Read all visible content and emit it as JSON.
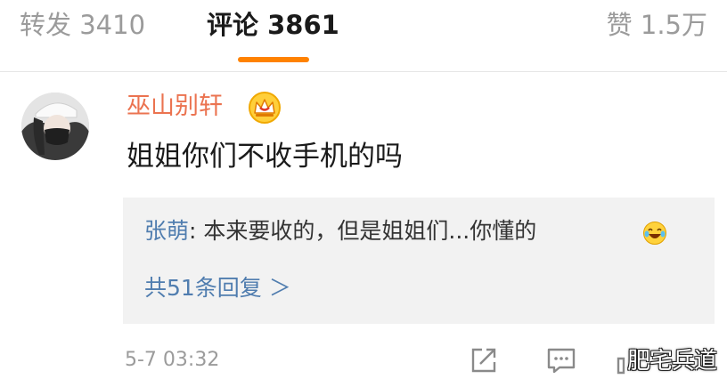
{
  "tabs": {
    "repost": "转发 3410",
    "comment": "评论 3861",
    "like": "赞 1.5万"
  },
  "comment": {
    "username": "巫山别轩",
    "text": "姐姐你们不收手机的吗",
    "timestamp": "5-7 03:32",
    "avatar_icon": "user-avatar-photo",
    "badge_icon": "vip-crown-icon"
  },
  "reply": {
    "author": "张萌",
    "separator": ": ",
    "text": "本来要收的，但是姐姐们...你懂的",
    "emoji_icon": "laugh-cry-emoji",
    "count_link": "共51条回复 ＞"
  },
  "watermark": "肥宅兵道",
  "colors": {
    "accent": "#ff8200",
    "username": "#eb7350",
    "link": "#507daf",
    "muted": "#9b9b9b"
  }
}
